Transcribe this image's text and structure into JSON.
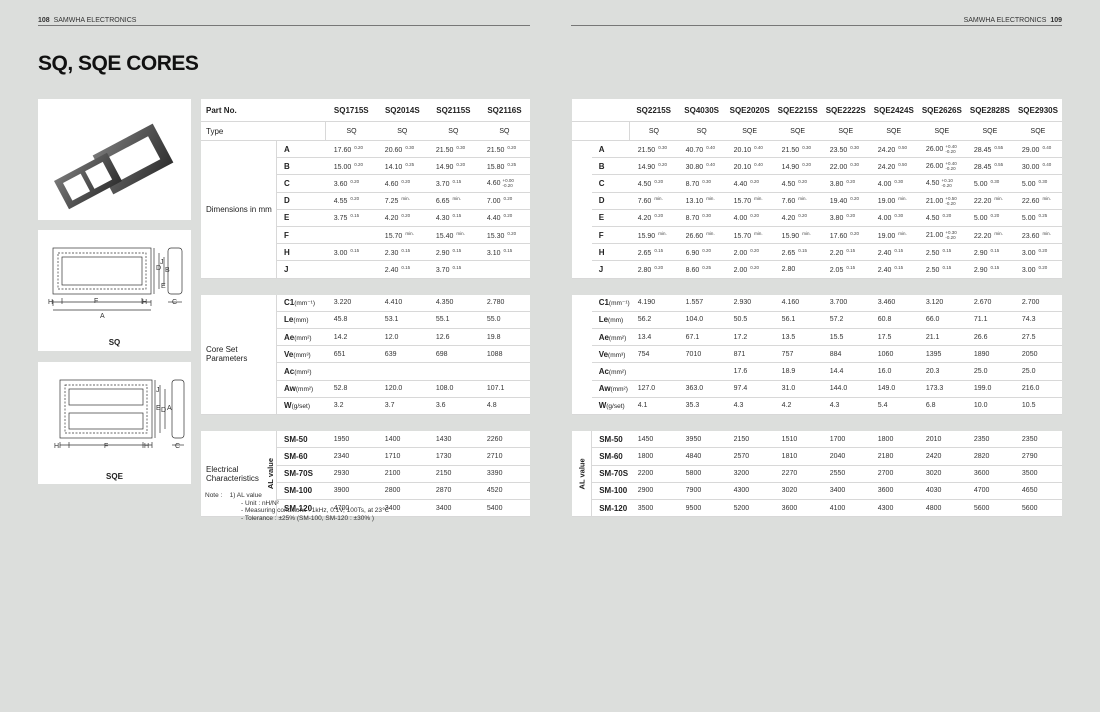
{
  "header": {
    "left_page": "108",
    "left_brand": "SAMWHA ELECTRONICS",
    "right_brand": "SAMWHA ELECTRONICS",
    "right_page": "109"
  },
  "page_title": "SQ, SQE CORES",
  "figures": {
    "sq_label": "SQ",
    "sqe_label": "SQE"
  },
  "labels": {
    "part_no": "Part No.",
    "type": "Type",
    "dimensions": "Dimensions in mm",
    "core_set": "Core Set Parameters",
    "electrical": "Electrical Characteristics",
    "al_value": "AL value"
  },
  "dim_rows": [
    "A",
    "B",
    "C",
    "D",
    "E",
    "F",
    "H",
    "J"
  ],
  "core_rows": [
    {
      "sym": "C1",
      "unit": "(mm⁻¹)"
    },
    {
      "sym": "Le",
      "unit": "(mm)"
    },
    {
      "sym": "Ae",
      "unit": "(mm²)"
    },
    {
      "sym": "Ve",
      "unit": "(mm³)"
    },
    {
      "sym": "Ac",
      "unit": "(mm²)"
    },
    {
      "sym": "Aw",
      "unit": "(mm²)"
    },
    {
      "sym": "W",
      "unit": "(g/set)"
    }
  ],
  "material_rows": [
    "SM-50",
    "SM-60",
    "SM-70S",
    "SM-100",
    "SM-120"
  ],
  "left_table": {
    "parts": [
      "SQ1715S",
      "SQ2014S",
      "SQ2115S",
      "SQ2116S"
    ],
    "types": [
      "SQ",
      "SQ",
      "SQ",
      "SQ"
    ],
    "dims": [
      [
        [
          "17.60",
          "0.20"
        ],
        [
          "20.60",
          "0.30"
        ],
        [
          "21.50",
          "0.30"
        ],
        [
          "21.50",
          "0.20"
        ]
      ],
      [
        [
          "15.00",
          "0.20"
        ],
        [
          "14.10",
          "0.25"
        ],
        [
          "14.90",
          "0.20"
        ],
        [
          "15.80",
          "0.25"
        ]
      ],
      [
        [
          "3.60",
          "0.20"
        ],
        [
          "4.60",
          "0.20"
        ],
        [
          "3.70",
          "0.15"
        ],
        [
          "4.60",
          "+0.00|-0.20"
        ]
      ],
      [
        [
          "4.55",
          "0.20"
        ],
        [
          "7.25",
          "min."
        ],
        [
          "6.65",
          "min."
        ],
        [
          "7.00",
          "0.20"
        ]
      ],
      [
        [
          "3.75",
          "0.15"
        ],
        [
          "4.20",
          "0.20"
        ],
        [
          "4.30",
          "0.15"
        ],
        [
          "4.40",
          "0.20"
        ]
      ],
      [
        [
          "",
          ""
        ],
        [
          "15.70",
          "min."
        ],
        [
          "15.40",
          "min."
        ],
        [
          "15.30",
          "0.20"
        ]
      ],
      [
        [
          "3.00",
          "0.15"
        ],
        [
          "2.30",
          "0.15"
        ],
        [
          "2.90",
          "0.15"
        ],
        [
          "3.10",
          "0.15"
        ]
      ],
      [
        [
          "",
          ""
        ],
        [
          "2.40",
          "0.15"
        ],
        [
          "3.70",
          "0.15"
        ],
        [
          "",
          ""
        ]
      ]
    ],
    "core": [
      [
        "3.220",
        "4.410",
        "4.350",
        "2.780"
      ],
      [
        "45.8",
        "53.1",
        "55.1",
        "55.0"
      ],
      [
        "14.2",
        "12.0",
        "12.6",
        "19.8"
      ],
      [
        "651",
        "639",
        "698",
        "1088"
      ],
      [
        "",
        "",
        "",
        ""
      ],
      [
        "52.8",
        "120.0",
        "108.0",
        "107.1"
      ],
      [
        "3.2",
        "3.7",
        "3.6",
        "4.8"
      ]
    ],
    "al": [
      [
        "1950",
        "1400",
        "1430",
        "2260"
      ],
      [
        "2340",
        "1710",
        "1730",
        "2710"
      ],
      [
        "2930",
        "2100",
        "2150",
        "3390"
      ],
      [
        "3900",
        "2800",
        "2870",
        "4520"
      ],
      [
        "4700",
        "3400",
        "3400",
        "5400"
      ]
    ]
  },
  "right_table": {
    "parts": [
      "SQ2215S",
      "SQ4030S",
      "SQE2020S",
      "SQE2215S",
      "SQE2222S",
      "SQE2424S",
      "SQE2626S",
      "SQE2828S",
      "SQE2930S"
    ],
    "types": [
      "SQ",
      "SQ",
      "SQE",
      "SQE",
      "SQE",
      "SQE",
      "SQE",
      "SQE",
      "SQE"
    ],
    "dims": [
      [
        [
          "21.50",
          "0.30"
        ],
        [
          "40.70",
          "0.40"
        ],
        [
          "20.10",
          "0.40"
        ],
        [
          "21.50",
          "0.30"
        ],
        [
          "23.50",
          "0.30"
        ],
        [
          "24.20",
          "0.50"
        ],
        [
          "26.00",
          "+0.40|-0.20"
        ],
        [
          "28.45",
          "0.55"
        ],
        [
          "29.00",
          "0.40"
        ]
      ],
      [
        [
          "14.90",
          "0.20"
        ],
        [
          "30.80",
          "0.40"
        ],
        [
          "20.10",
          "0.40"
        ],
        [
          "14.90",
          "0.20"
        ],
        [
          "22.00",
          "0.30"
        ],
        [
          "24.20",
          "0.50"
        ],
        [
          "26.00",
          "+0.40|-0.20"
        ],
        [
          "28.45",
          "0.55"
        ],
        [
          "30.00",
          "0.40"
        ]
      ],
      [
        [
          "4.50",
          "0.20"
        ],
        [
          "8.70",
          "0.30"
        ],
        [
          "4.40",
          "0.20"
        ],
        [
          "4.50",
          "0.20"
        ],
        [
          "3.80",
          "0.20"
        ],
        [
          "4.00",
          "0.30"
        ],
        [
          "4.50",
          "+0.10|-0.20"
        ],
        [
          "5.00",
          "0.30"
        ],
        [
          "5.00",
          "0.30"
        ]
      ],
      [
        [
          "7.60",
          "min."
        ],
        [
          "13.10",
          "min."
        ],
        [
          "15.70",
          "min."
        ],
        [
          "7.60",
          "min."
        ],
        [
          "19.40",
          "0.20"
        ],
        [
          "19.00",
          "min."
        ],
        [
          "21.00",
          "+0.50|-0.20"
        ],
        [
          "22.20",
          "min."
        ],
        [
          "22.60",
          "min."
        ]
      ],
      [
        [
          "4.20",
          "0.20"
        ],
        [
          "8.70",
          "0.30"
        ],
        [
          "4.00",
          "0.20"
        ],
        [
          "4.20",
          "0.20"
        ],
        [
          "3.80",
          "0.20"
        ],
        [
          "4.00",
          "0.30"
        ],
        [
          "4.50",
          "0.20"
        ],
        [
          "5.00",
          "0.20"
        ],
        [
          "5.00",
          "0.25"
        ]
      ],
      [
        [
          "15.90",
          "min."
        ],
        [
          "26.60",
          "min."
        ],
        [
          "15.70",
          "min."
        ],
        [
          "15.90",
          "min."
        ],
        [
          "17.60",
          "0.20"
        ],
        [
          "19.00",
          "min."
        ],
        [
          "21.00",
          "+0.30|-0.20"
        ],
        [
          "22.20",
          "min."
        ],
        [
          "23.60",
          "min."
        ]
      ],
      [
        [
          "2.65",
          "0.15"
        ],
        [
          "6.90",
          "0.20"
        ],
        [
          "2.00",
          "0.20"
        ],
        [
          "2.65",
          "0.15"
        ],
        [
          "2.20",
          "0.15"
        ],
        [
          "2.40",
          "0.15"
        ],
        [
          "2.50",
          "0.15"
        ],
        [
          "2.90",
          "0.15"
        ],
        [
          "3.00",
          "0.20"
        ]
      ],
      [
        [
          "2.80",
          "0.20"
        ],
        [
          "8.60",
          "0.25"
        ],
        [
          "2.00",
          "0.20"
        ],
        [
          "2.80",
          ""
        ],
        [
          "2.05",
          "0.15"
        ],
        [
          "2.40",
          "0.15"
        ],
        [
          "2.50",
          "0.15"
        ],
        [
          "2.90",
          "0.15"
        ],
        [
          "3.00",
          "0.20"
        ]
      ]
    ],
    "core": [
      [
        "4.190",
        "1.557",
        "2.930",
        "4.160",
        "3.700",
        "3.460",
        "3.120",
        "2.670",
        "2.700"
      ],
      [
        "56.2",
        "104.0",
        "50.5",
        "56.1",
        "57.2",
        "60.8",
        "66.0",
        "71.1",
        "74.3"
      ],
      [
        "13.4",
        "67.1",
        "17.2",
        "13.5",
        "15.5",
        "17.5",
        "21.1",
        "26.6",
        "27.5"
      ],
      [
        "754",
        "7010",
        "871",
        "757",
        "884",
        "1060",
        "1395",
        "1890",
        "2050"
      ],
      [
        "",
        "",
        "17.6",
        "18.9",
        "14.4",
        "16.0",
        "20.3",
        "25.0",
        "25.0"
      ],
      [
        "127.0",
        "363.0",
        "97.4",
        "31.0",
        "144.0",
        "149.0",
        "173.3",
        "199.0",
        "216.0"
      ],
      [
        "4.1",
        "35.3",
        "4.3",
        "4.2",
        "4.3",
        "5.4",
        "6.8",
        "10.0",
        "10.5"
      ]
    ],
    "al": [
      [
        "1450",
        "3950",
        "2150",
        "1510",
        "1700",
        "1800",
        "2010",
        "2350",
        "2350"
      ],
      [
        "1800",
        "4840",
        "2570",
        "1810",
        "2040",
        "2180",
        "2420",
        "2820",
        "2790"
      ],
      [
        "2200",
        "5800",
        "3200",
        "2270",
        "2550",
        "2700",
        "3020",
        "3600",
        "3500"
      ],
      [
        "2900",
        "7900",
        "4300",
        "3020",
        "3400",
        "3600",
        "4030",
        "4700",
        "4650"
      ],
      [
        "3500",
        "9500",
        "5200",
        "3600",
        "4100",
        "4300",
        "4800",
        "5600",
        "5600"
      ]
    ]
  },
  "note": {
    "label": "Note :",
    "item": "1) AL value",
    "lines": [
      "- Unit : nH/N²",
      "- Measuring conditions : 1kHz, 0.1V, 100Ts, at 23℃",
      "- Tolerance : ±25% (SM-100, SM-120 : ±30% )"
    ]
  }
}
